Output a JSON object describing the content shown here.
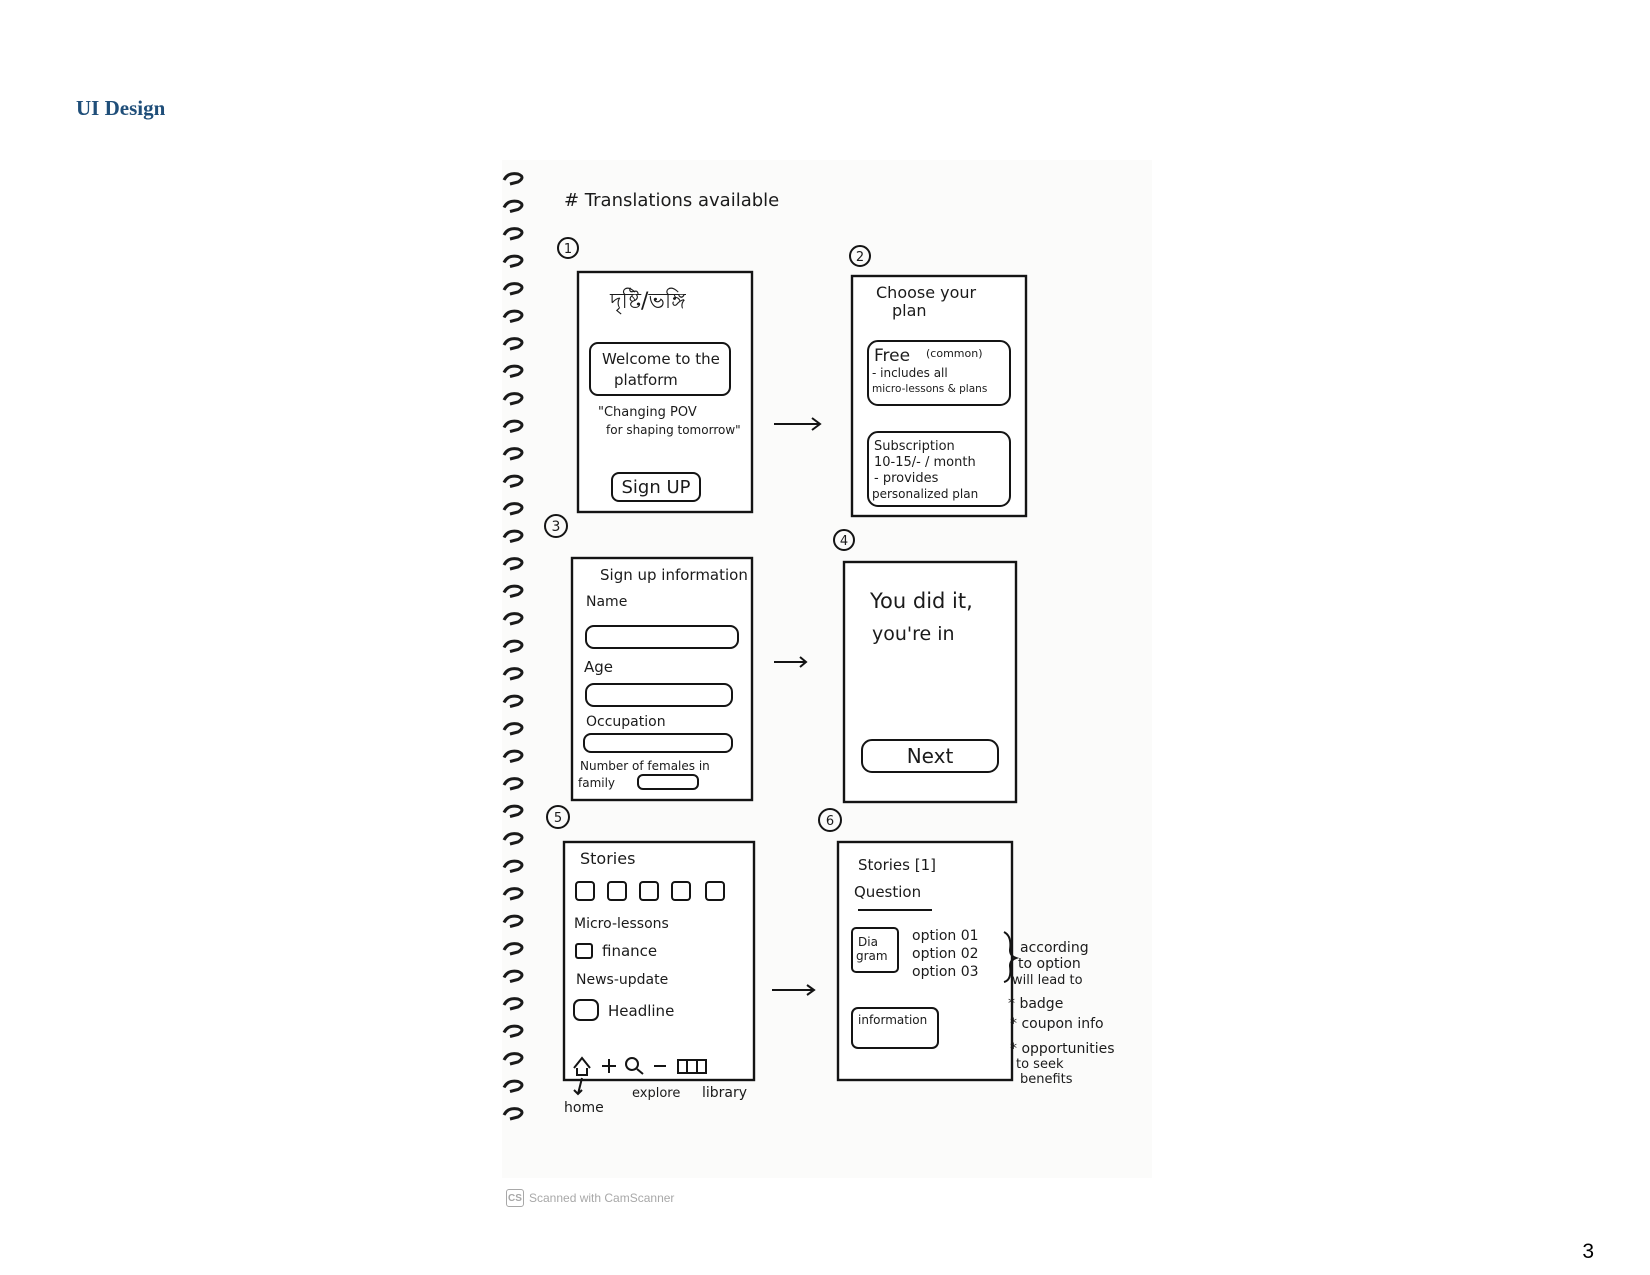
{
  "document": {
    "heading": "UI Design",
    "page_number": "3"
  },
  "sketch": {
    "note": "# Translations available",
    "screen1": {
      "number": "1",
      "logo": "দৃষ্টি/ভঙ্গি",
      "welcome_line1": "Welcome to the",
      "welcome_line2": "platform",
      "tagline_line1": "\"Changing POV",
      "tagline_line2": "for shaping tomorrow\"",
      "signup": "Sign UP"
    },
    "screen2": {
      "number": "2",
      "title_line1": "Choose your",
      "title_line2": "plan",
      "free_title": "Free",
      "free_tag": "(common)",
      "free_line1": "- includes all",
      "free_line2": "micro-lessons & plans",
      "sub_line1": "Subscription",
      "sub_line2": "10-15/- / month",
      "sub_line3": "- provides",
      "sub_line4": "personalized plan"
    },
    "screen3": {
      "number": "3",
      "title": "Sign up information",
      "name_label": "Name",
      "age_label": "Age",
      "occupation_label": "Occupation",
      "females_line1": "Number of females in",
      "females_line2": "family"
    },
    "screen4": {
      "number": "4",
      "message_line1": "You did it,",
      "message_line2": "you're in",
      "next": "Next"
    },
    "screen5": {
      "number": "5",
      "stories": "Stories",
      "micro_lessons": "Micro-lessons",
      "finance": "finance",
      "news": "News-update",
      "headline": "Headline",
      "home_label": "home",
      "explore_label": "explore",
      "library_label": "library"
    },
    "screen6": {
      "number": "6",
      "title": "Stories [1]",
      "question": "Question",
      "diagram_line1": "Dia",
      "diagram_line2": "gram",
      "option1": "option 01",
      "option2": "option 02",
      "option3": "option 03",
      "information": "information",
      "side_line1": "according",
      "side_line2": "to option",
      "side_line3": "will lead to",
      "side_line4": "* badge",
      "side_line5": "* coupon info",
      "side_line6": "* opportunities",
      "side_line7": "to seek",
      "side_line8": "benefits"
    },
    "watermark": {
      "logo": "CS",
      "text": "Scanned with CamScanner"
    }
  }
}
